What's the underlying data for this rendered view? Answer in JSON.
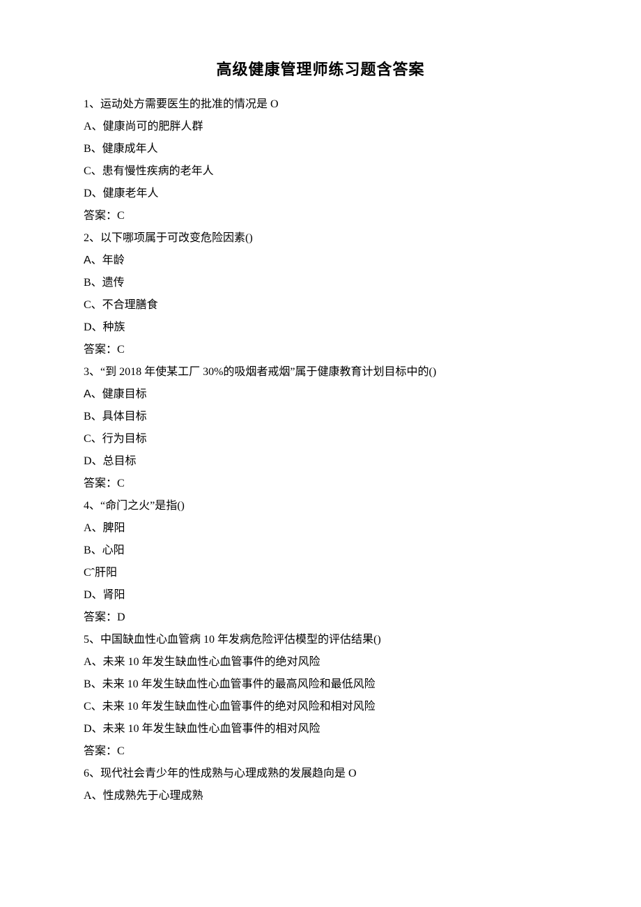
{
  "title": "高级健康管理师练习题含答案",
  "lines": [
    {
      "text": "1、运动处方需要医生的批准的情况是 O",
      "cls": ""
    },
    {
      "text": "A、健康尚可的肥胖人群",
      "cls": ""
    },
    {
      "text": "B、健康成年人",
      "cls": ""
    },
    {
      "text": "C、患有慢性疾病的老年人",
      "cls": ""
    },
    {
      "text": "D、健康老年人",
      "cls": ""
    },
    {
      "text": "答案：C",
      "cls": ""
    },
    {
      "text": "2、以下哪项属于可改变危险因素()",
      "cls": ""
    },
    {
      "text": "A、年龄",
      "cls": "sans"
    },
    {
      "text": "B、遗传",
      "cls": ""
    },
    {
      "text": "C、不合理膳食",
      "cls": ""
    },
    {
      "text": "D、种族",
      "cls": ""
    },
    {
      "text": "答案：C",
      "cls": ""
    },
    {
      "text": "3、“到 2018 年使某工厂 30%的吸烟者戒烟”属于健康教育计划目标中的()",
      "cls": ""
    },
    {
      "text": "A、健康目标",
      "cls": "sans"
    },
    {
      "text": "B、具体目标",
      "cls": ""
    },
    {
      "text": "C、行为目标",
      "cls": ""
    },
    {
      "text": "D、总目标",
      "cls": ""
    },
    {
      "text": "答案：C",
      "cls": ""
    },
    {
      "text": "4、“命门之火”是指()",
      "cls": ""
    },
    {
      "text": "A、脾阳",
      "cls": ""
    },
    {
      "text": "B、心阳",
      "cls": ""
    },
    {
      "text": "Cˆ肝阳",
      "cls": ""
    },
    {
      "text": "D、肾阳",
      "cls": ""
    },
    {
      "text": "答案：D",
      "cls": ""
    },
    {
      "text": "5、中国缺血性心血管病 10 年发病危险评估模型的评估结果()",
      "cls": ""
    },
    {
      "text": "A、未来 10 年发生缺血性心血管事件的绝对风险",
      "cls": ""
    },
    {
      "text": "B、未来 10 年发生缺血性心血管事件的最高风险和最低风险",
      "cls": ""
    },
    {
      "text": "C、未来 10 年发生缺血性心血管事件的绝对风险和相对风险",
      "cls": ""
    },
    {
      "text": "D、未来 10 年发生缺血性心血管事件的相对风险",
      "cls": ""
    },
    {
      "text": "答案：C",
      "cls": ""
    },
    {
      "text": "6、现代社会青少年的性成熟与心理成熟的发展趋向是 O",
      "cls": ""
    },
    {
      "text": "A、性成熟先于心理成熟",
      "cls": ""
    }
  ]
}
